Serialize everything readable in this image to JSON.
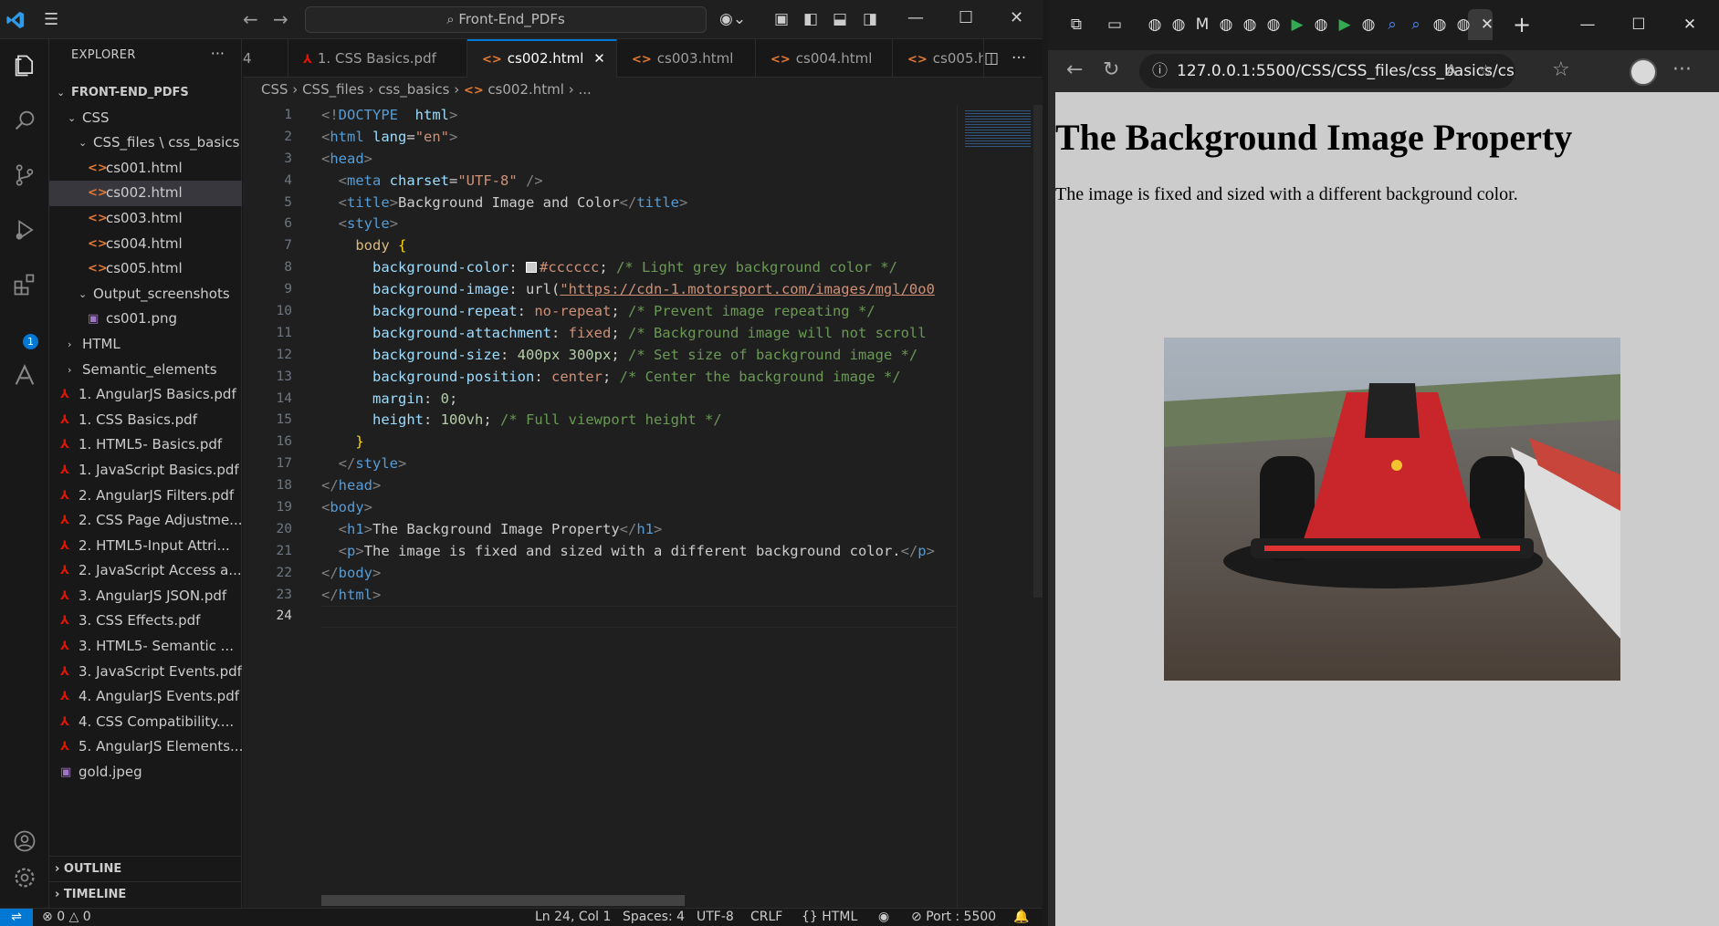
{
  "titlebar": {
    "search_text": "Front-End_PDFs"
  },
  "sidebar": {
    "header": "EXPLORER",
    "tree": [
      {
        "label": "FRONT-END_PDFS",
        "kind": "folder-open",
        "depth": 0,
        "bold": true
      },
      {
        "label": "CSS",
        "kind": "folder-open",
        "depth": 1
      },
      {
        "label": "CSS_files \\ css_basics",
        "kind": "folder-open",
        "depth": 2
      },
      {
        "label": "cs001.html",
        "kind": "html",
        "depth": 3
      },
      {
        "label": "cs002.html",
        "kind": "html",
        "depth": 3,
        "selected": true
      },
      {
        "label": "cs003.html",
        "kind": "html",
        "depth": 3
      },
      {
        "label": "cs004.html",
        "kind": "html",
        "depth": 3
      },
      {
        "label": "cs005.html",
        "kind": "html",
        "depth": 3
      },
      {
        "label": "Output_screenshots",
        "kind": "folder-open",
        "depth": 2
      },
      {
        "label": "cs001.png",
        "kind": "img",
        "depth": 3
      },
      {
        "label": "HTML",
        "kind": "folder-closed",
        "depth": 1
      },
      {
        "label": "Semantic_elements",
        "kind": "folder-closed",
        "depth": 1
      },
      {
        "label": "1. AngularJS Basics.pdf",
        "kind": "pdf",
        "depth": 1
      },
      {
        "label": "1. CSS Basics.pdf",
        "kind": "pdf",
        "depth": 1
      },
      {
        "label": "1. HTML5- Basics.pdf",
        "kind": "pdf",
        "depth": 1
      },
      {
        "label": "1. JavaScript Basics.pdf",
        "kind": "pdf",
        "depth": 1
      },
      {
        "label": "2. AngularJS Filters.pdf",
        "kind": "pdf",
        "depth": 1
      },
      {
        "label": "2. CSS Page Adjustme...",
        "kind": "pdf",
        "depth": 1
      },
      {
        "label": "2. HTML5-Input Attri...",
        "kind": "pdf",
        "depth": 1
      },
      {
        "label": "2. JavaScript Access a...",
        "kind": "pdf",
        "depth": 1
      },
      {
        "label": "3. AngularJS JSON.pdf",
        "kind": "pdf",
        "depth": 1
      },
      {
        "label": "3. CSS Effects.pdf",
        "kind": "pdf",
        "depth": 1
      },
      {
        "label": "3. HTML5- Semantic ...",
        "kind": "pdf",
        "depth": 1
      },
      {
        "label": "3. JavaScript Events.pdf",
        "kind": "pdf",
        "depth": 1
      },
      {
        "label": "4. AngularJS Events.pdf",
        "kind": "pdf",
        "depth": 1
      },
      {
        "label": "4. CSS Compatibility....",
        "kind": "pdf",
        "depth": 1
      },
      {
        "label": "5. AngularJS Elements...",
        "kind": "pdf",
        "depth": 1
      },
      {
        "label": "gold.jpeg",
        "kind": "img",
        "depth": 1
      }
    ],
    "outline": "OUTLINE",
    "timeline": "TIMELINE"
  },
  "tabs": [
    {
      "label": "4",
      "kind": "none"
    },
    {
      "label": "1. CSS Basics.pdf",
      "kind": "pdf"
    },
    {
      "label": "cs002.html",
      "kind": "html",
      "active": true
    },
    {
      "label": "cs003.html",
      "kind": "html"
    },
    {
      "label": "cs004.html",
      "kind": "html"
    },
    {
      "label": "cs005.h",
      "kind": "html"
    }
  ],
  "breadcrumb": [
    "CSS",
    "CSS_files",
    "css_basics",
    "cs002.html",
    "..."
  ],
  "code_lines": [
    [
      [
        "t-tag",
        "<!"
      ],
      [
        "t-tn",
        "DOCTYPE"
      ],
      [
        "",
        "  "
      ],
      [
        "t-att",
        "html"
      ],
      [
        "t-tag",
        ">"
      ]
    ],
    [
      [
        "t-tag",
        "<"
      ],
      [
        "t-tn",
        "html"
      ],
      [
        "",
        ""
      ],
      [
        "t-att",
        " lang"
      ],
      [
        "",
        "="
      ],
      [
        "t-str",
        "\"en\""
      ],
      [
        "t-tag",
        ">"
      ]
    ],
    [
      [
        "t-tag",
        "<"
      ],
      [
        "t-tn",
        "head"
      ],
      [
        "t-tag",
        ">"
      ]
    ],
    [
      [
        "",
        "  "
      ],
      [
        "t-tag",
        "<"
      ],
      [
        "t-tn",
        "meta"
      ],
      [
        "t-att",
        " charset"
      ],
      [
        "",
        "="
      ],
      [
        "t-str",
        "\"UTF-8\""
      ],
      [
        "t-tag",
        " />"
      ]
    ],
    [
      [
        "",
        "  "
      ],
      [
        "t-tag",
        "<"
      ],
      [
        "t-tn",
        "title"
      ],
      [
        "t-tag",
        ">"
      ],
      [
        "",
        "Background Image and Color"
      ],
      [
        "t-tag",
        "</"
      ],
      [
        "t-tn",
        "title"
      ],
      [
        "t-tag",
        ">"
      ]
    ],
    [
      [
        "",
        "  "
      ],
      [
        "t-tag",
        "<"
      ],
      [
        "t-tn",
        "style"
      ],
      [
        "t-tag",
        ">"
      ]
    ],
    [
      [
        "",
        "    "
      ],
      [
        "t-sel",
        "body"
      ],
      [
        "t-brace",
        " {"
      ]
    ],
    [
      [
        "",
        "      "
      ],
      [
        "t-prop",
        "background-color"
      ],
      [
        "",
        ": "
      ],
      [
        "swatch",
        ""
      ],
      [
        "t-val",
        "#cccccc"
      ],
      [
        "",
        "; "
      ],
      [
        "t-cmt",
        "/* Light grey background color */"
      ]
    ],
    [
      [
        "",
        "      "
      ],
      [
        "t-prop",
        "background-image"
      ],
      [
        "",
        ": url("
      ],
      [
        "t-url",
        "\"https://cdn-1.motorsport.com/images/mgl/0o0"
      ]
    ],
    [
      [
        "",
        "      "
      ],
      [
        "t-prop",
        "background-repeat"
      ],
      [
        "",
        ": "
      ],
      [
        "t-val",
        "no-repeat"
      ],
      [
        "",
        "; "
      ],
      [
        "t-cmt",
        "/* Prevent image repeating */"
      ]
    ],
    [
      [
        "",
        "      "
      ],
      [
        "t-prop",
        "background-attachment"
      ],
      [
        "",
        ": "
      ],
      [
        "t-val",
        "fixed"
      ],
      [
        "",
        "; "
      ],
      [
        "t-cmt",
        "/* Background image will not scroll"
      ]
    ],
    [
      [
        "",
        "      "
      ],
      [
        "t-prop",
        "background-size"
      ],
      [
        "",
        ": "
      ],
      [
        "t-num",
        "400px 300px"
      ],
      [
        "",
        "; "
      ],
      [
        "t-cmt",
        "/* Set size of background image */"
      ]
    ],
    [
      [
        "",
        "      "
      ],
      [
        "t-prop",
        "background-position"
      ],
      [
        "",
        ": "
      ],
      [
        "t-val",
        "center"
      ],
      [
        "",
        "; "
      ],
      [
        "t-cmt",
        "/* Center the background image */"
      ]
    ],
    [
      [
        "",
        "      "
      ],
      [
        "t-prop",
        "margin"
      ],
      [
        "",
        ": "
      ],
      [
        "t-num",
        "0"
      ],
      [
        "",
        ";"
      ]
    ],
    [
      [
        "",
        "      "
      ],
      [
        "t-prop",
        "height"
      ],
      [
        "",
        ": "
      ],
      [
        "t-num",
        "100vh"
      ],
      [
        "",
        "; "
      ],
      [
        "t-cmt",
        "/* Full viewport height */"
      ]
    ],
    [
      [
        "",
        "    "
      ],
      [
        "t-brace",
        "}"
      ]
    ],
    [
      [
        "",
        "  "
      ],
      [
        "t-tag",
        "</"
      ],
      [
        "t-tn",
        "style"
      ],
      [
        "t-tag",
        ">"
      ]
    ],
    [
      [
        "t-tag",
        "</"
      ],
      [
        "t-tn",
        "head"
      ],
      [
        "t-tag",
        ">"
      ]
    ],
    [
      [
        "t-tag",
        "<"
      ],
      [
        "t-tn",
        "body"
      ],
      [
        "t-tag",
        ">"
      ]
    ],
    [
      [
        "",
        "  "
      ],
      [
        "t-tag",
        "<"
      ],
      [
        "t-tn",
        "h1"
      ],
      [
        "t-tag",
        ">"
      ],
      [
        "",
        "The Background Image Property"
      ],
      [
        "t-tag",
        "</"
      ],
      [
        "t-tn",
        "h1"
      ],
      [
        "t-tag",
        ">"
      ]
    ],
    [
      [
        "",
        "  "
      ],
      [
        "t-tag",
        "<"
      ],
      [
        "t-tn",
        "p"
      ],
      [
        "t-tag",
        ">"
      ],
      [
        "",
        "The image is fixed and sized with a different background color."
      ],
      [
        "t-tag",
        "</"
      ],
      [
        "t-tn",
        "p"
      ],
      [
        "t-tag",
        ">"
      ]
    ],
    [
      [
        "t-tag",
        "</"
      ],
      [
        "t-tn",
        "body"
      ],
      [
        "t-tag",
        ">"
      ]
    ],
    [
      [
        "t-tag",
        "</"
      ],
      [
        "t-tn",
        "html"
      ],
      [
        "t-tag",
        ">"
      ]
    ],
    [
      [
        "",
        ""
      ]
    ]
  ],
  "current_line": 24,
  "status": {
    "errors": "0",
    "warnings": "0",
    "position": "Ln 24, Col 1",
    "spaces": "Spaces: 4",
    "encoding": "UTF-8",
    "eol": "CRLF",
    "language": "HTML",
    "port": "Port : 5500"
  },
  "browser": {
    "address": "127.0.0.1:5500/CSS/CSS_files/css_basics/cs...",
    "page": {
      "h1": "The Background Image Property",
      "p": "The image is fixed and sized with a different background color."
    }
  },
  "colors": {
    "accent": "#0078d4",
    "page_bg": "#cccccc",
    "html_icon": "#e37933",
    "pdf_icon": "#e51400"
  }
}
